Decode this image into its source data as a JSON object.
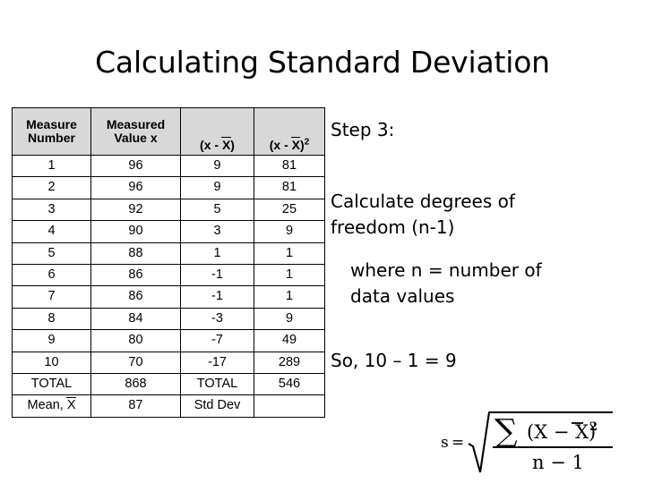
{
  "slide": {
    "title": "Calculating Standard Deviation",
    "background_color": "#ffffff",
    "text_color": "#000000"
  },
  "table": {
    "header_background": "#d8d8d8",
    "border_color": "#000000",
    "headers": [
      {
        "line1": "Measure",
        "line2": "Number"
      },
      {
        "line1": "Measured",
        "line2": "Value x"
      },
      {
        "symbol": "(x - X̅)"
      },
      {
        "symbol": "(x - X̅)²"
      }
    ],
    "rows": [
      {
        "n": "1",
        "x": "96",
        "dev": "9",
        "dev_sq": "81"
      },
      {
        "n": "2",
        "x": "96",
        "dev": "9",
        "dev_sq": "81"
      },
      {
        "n": "3",
        "x": "92",
        "dev": "5",
        "dev_sq": "25"
      },
      {
        "n": "4",
        "x": "90",
        "dev": "3",
        "dev_sq": "9"
      },
      {
        "n": "5",
        "x": "88",
        "dev": "1",
        "dev_sq": "1"
      },
      {
        "n": "6",
        "x": "86",
        "dev": "-1",
        "dev_sq": "1"
      },
      {
        "n": "7",
        "x": "86",
        "dev": "-1",
        "dev_sq": "1"
      },
      {
        "n": "8",
        "x": "84",
        "dev": "-3",
        "dev_sq": "9"
      },
      {
        "n": "9",
        "x": "80",
        "dev": "-7",
        "dev_sq": "49"
      },
      {
        "n": "10",
        "x": "70",
        "dev": "-17",
        "dev_sq": "289"
      },
      {
        "n": "TOTAL",
        "x": "868",
        "dev": "TOTAL",
        "dev_sq": "546"
      },
      {
        "n": "Mean,",
        "x": "87",
        "dev": "Std Dev",
        "dev_sq": ""
      }
    ],
    "mean_label_symbol": "X"
  },
  "content": {
    "step_label": "Step 3:",
    "instruction_line1": "Calculate degrees of",
    "instruction_line2": "freedom (n-1)",
    "instruction_line3": "where n = number of",
    "instruction_line4": "data values",
    "result": "So, 10 – 1 = 9"
  },
  "formula": {
    "description": "s = sqrt( sum (X - Xbar)^2 / (n - 1) )",
    "lhs": "s",
    "equals": "=",
    "sigma": "∑",
    "numerator": "(X − X̅)",
    "numerator_exponent": "2",
    "denominator": "n − 1"
  }
}
